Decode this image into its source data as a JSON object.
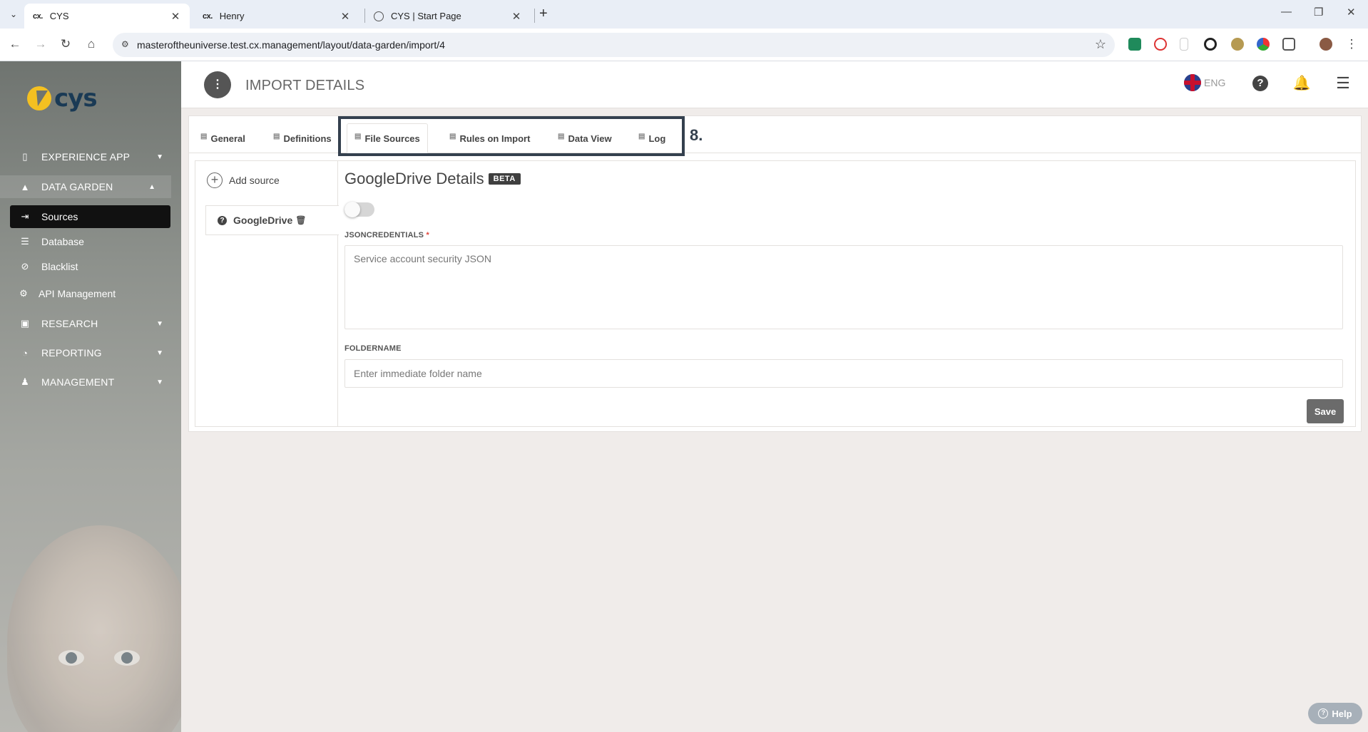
{
  "browser": {
    "tabs": [
      {
        "favicon": "cx.",
        "title": "CYS"
      },
      {
        "favicon": "cx.",
        "title": "Henry"
      },
      {
        "favicon": "globe-icon",
        "title": "CYS | Start Page"
      }
    ],
    "url": "masteroftheuniverse.test.cx.management/layout/data-garden/import/4"
  },
  "sidebar": {
    "logo_text": "cys",
    "items": [
      {
        "label": "EXPERIENCE APP",
        "icon": "phone-icon"
      },
      {
        "label": "DATA GARDEN",
        "icon": "tree-icon"
      },
      {
        "label": "Sources",
        "icon": "import-icon"
      },
      {
        "label": "Database",
        "icon": "database-icon"
      },
      {
        "label": "Blacklist",
        "icon": "ban-icon"
      },
      {
        "label": "API Management",
        "icon": "gear-icon"
      },
      {
        "label": "RESEARCH",
        "icon": "inbox-icon"
      },
      {
        "label": "REPORTING",
        "icon": "pie-chart-icon"
      },
      {
        "label": "MANAGEMENT",
        "icon": "user-tie-icon"
      }
    ]
  },
  "header": {
    "title": "IMPORT DETAILS",
    "language": "ENG"
  },
  "tabs": [
    {
      "label": "General"
    },
    {
      "label": "Definitions"
    },
    {
      "label": "File Sources"
    },
    {
      "label": "Rules on Import"
    },
    {
      "label": "Data View"
    },
    {
      "label": "Log"
    }
  ],
  "annotation": {
    "step": "8."
  },
  "sources": {
    "add_label": "Add source",
    "items": [
      {
        "label": "GoogleDrive"
      }
    ]
  },
  "details": {
    "title": "GoogleDrive Details",
    "badge": "BETA",
    "enabled": false,
    "json_label": "JSONCREDENTIALS",
    "json_required": "*",
    "json_placeholder": "Service account security JSON",
    "folder_label": "FOLDERNAME",
    "folder_placeholder": "Enter immediate folder name",
    "save_label": "Save"
  },
  "help_button": "Help",
  "colors": {
    "highlight": "#34404e",
    "selected_nav": "#111111",
    "badge": "#3f3f3f",
    "logo_yellow": "#f4c021",
    "logo_navy": "#1a3a55"
  }
}
